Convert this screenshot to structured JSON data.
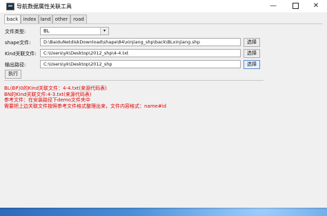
{
  "window": {
    "title": "导航数据属性关联工具",
    "controls": {
      "minimize": "—",
      "close": "✕"
    }
  },
  "tabs": [
    "back",
    "index",
    "land",
    "other",
    "road"
  ],
  "form": {
    "file_type_label": "文件类型:",
    "file_type_value": "BL",
    "shape_label": "shape文件:",
    "shape_value": "D:\\BaiduNetdiskDownload\\shape\\84\\xinjiang_shp\\back\\BLxinjiang.shp",
    "kind_label": "Kind关联文件:",
    "kind_value": "C:\\Users\\yk\\Desktop\\2012_shp\\4-4.txt",
    "output_label": "输出路径:",
    "output_value": "C:\\Users\\yk\\Desktop\\2012_shp",
    "browse_label": "选择",
    "run_label": "执行"
  },
  "output_lines": [
    "BL(BP)0的Kind关联文件：4-4.txt(来源代码表)",
    "BN的Kind关联文件:4-3.txt(来源代码表)",
    "参考文件：在安装路径下demo文件夹中",
    "需要把上边关联文件按照参考文件格式整理出来，文件内容格式：name#id"
  ],
  "colors": {
    "output_text": "#e00000",
    "desktop": "#2d6bbd"
  }
}
